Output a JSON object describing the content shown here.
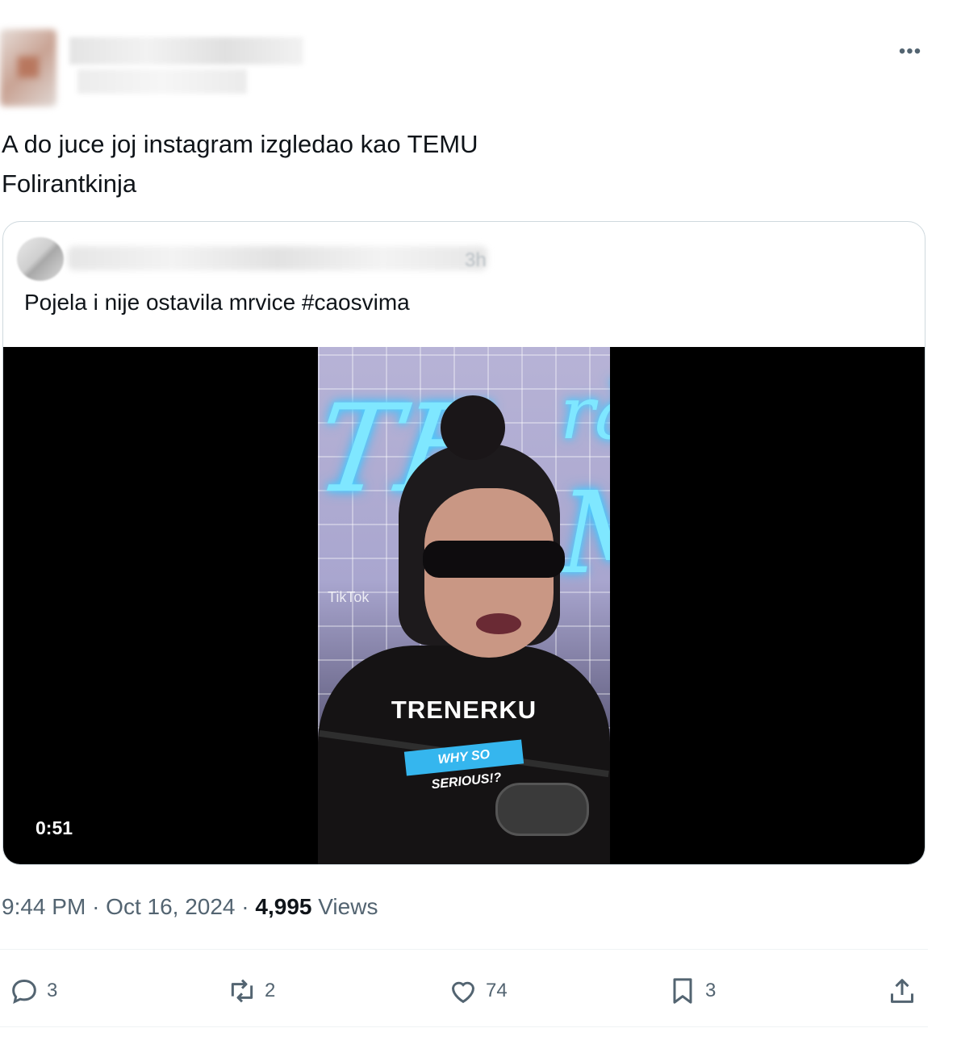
{
  "tweet": {
    "text": "A do juce joj instagram izgledao kao TEMU\nFolirantkinja",
    "time": "9:44 PM",
    "date": "Oct 16, 2024",
    "views_count": "4,995",
    "views_label": "Views",
    "separator": "·"
  },
  "quote": {
    "time_fragment": "3h",
    "text": "Pojela i nije ostavila mrvice #caosvima",
    "video": {
      "duration": "0:51",
      "caption": "TRENERKU",
      "tag": "WHY SO SERIOUS!?",
      "watermark": "TikTok"
    }
  },
  "actions": {
    "reply_count": "3",
    "retweet_count": "2",
    "like_count": "74",
    "bookmark_count": "3"
  },
  "colors": {
    "text": "#0f1419",
    "secondary": "#536471",
    "border": "#cfd9de",
    "tag_blue": "#35b6ee"
  }
}
